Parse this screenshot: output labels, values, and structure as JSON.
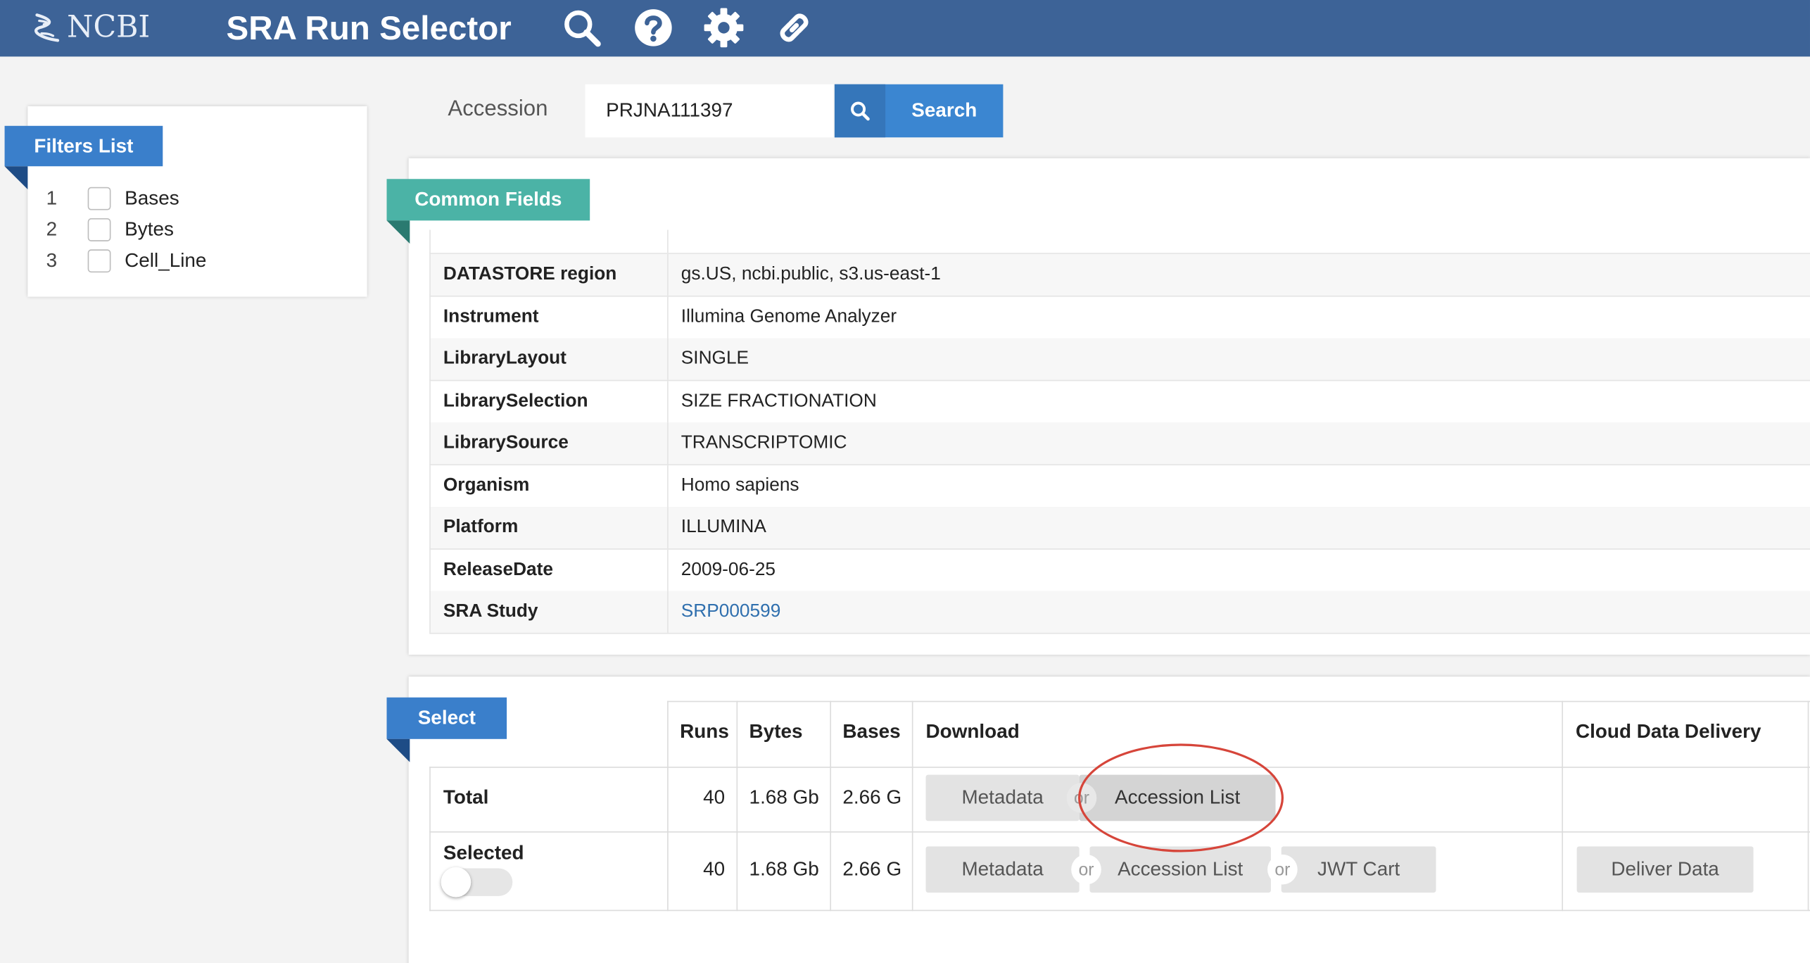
{
  "header": {
    "logo_text": "NCBI",
    "title": "SRA Run Selector",
    "icons": [
      "search-icon",
      "help-icon",
      "gear-icon",
      "link-icon"
    ]
  },
  "filters": {
    "title": "Filters List",
    "items": [
      {
        "num": "1",
        "label": "Bases"
      },
      {
        "num": "2",
        "label": "Bytes"
      },
      {
        "num": "3",
        "label": "Cell_Line"
      }
    ]
  },
  "search": {
    "label": "Accession",
    "value": "PRJNA111397",
    "button_label": "Search"
  },
  "common_fields": {
    "title": "Common Fields",
    "rows": [
      {
        "key": "DATASTORE region",
        "value": "gs.US, ncbi.public, s3.us-east-1"
      },
      {
        "key": "Instrument",
        "value": "Illumina Genome Analyzer"
      },
      {
        "key": "LibraryLayout",
        "value": "SINGLE"
      },
      {
        "key": "LibrarySelection",
        "value": "SIZE FRACTIONATION"
      },
      {
        "key": "LibrarySource",
        "value": "TRANSCRIPTOMIC"
      },
      {
        "key": "Organism",
        "value": "Homo sapiens"
      },
      {
        "key": "Platform",
        "value": "ILLUMINA"
      },
      {
        "key": "ReleaseDate",
        "value": "2009-06-25"
      },
      {
        "key": "SRA Study",
        "value": "SRP000599"
      }
    ]
  },
  "select": {
    "title": "Select",
    "headers": {
      "runs": "Runs",
      "bytes": "Bytes",
      "bases": "Bases",
      "download": "Download",
      "cloud": "Cloud Data Delivery"
    },
    "total": {
      "label": "Total",
      "runs": "40",
      "bytes": "1.68 Gb",
      "bases": "2.66 G"
    },
    "selected": {
      "label": "Selected",
      "runs": "40",
      "bytes": "1.68 Gb",
      "bases": "2.66 G"
    },
    "or_label": "or",
    "buttons": {
      "metadata": "Metadata",
      "accession_list": "Accession List",
      "jwt_cart": "JWT Cart",
      "deliver_data": "Deliver Data"
    }
  },
  "colors": {
    "topbar": "#3d6397",
    "ribbon_blue": "#3a7fcb",
    "ribbon_teal": "#4bb3a6",
    "annotation": "#d6453a"
  }
}
